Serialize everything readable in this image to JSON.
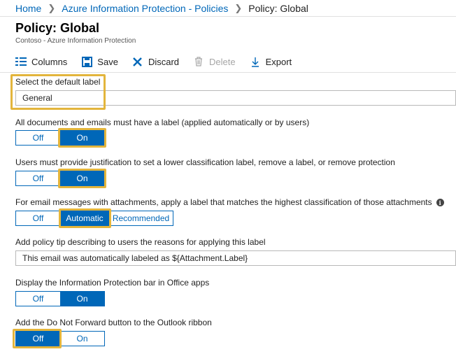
{
  "breadcrumb": {
    "items": [
      "Home",
      "Azure Information Protection - Policies"
    ],
    "current": "Policy: Global"
  },
  "page": {
    "title": "Policy: Global",
    "subtitle": "Contoso - Azure Information Protection"
  },
  "toolbar": {
    "columns": "Columns",
    "save": "Save",
    "discard": "Discard",
    "delete": "Delete",
    "export": "Export"
  },
  "settings": {
    "default_label": {
      "label": "Select the default label",
      "value": "General"
    },
    "mandatory_label": {
      "label": "All documents and emails must have a label (applied automatically or by users)",
      "off": "Off",
      "on": "On",
      "selected": "On"
    },
    "justification": {
      "label": "Users must provide justification to set a lower classification label, remove a label, or remove protection",
      "off": "Off",
      "on": "On",
      "selected": "On"
    },
    "attachments": {
      "label": "For email messages with attachments, apply a label that matches the highest classification of those attachments",
      "info_icon": "i",
      "off": "Off",
      "automatic": "Automatic",
      "recommended": "Recommended",
      "selected": "Automatic"
    },
    "policy_tip": {
      "label": "Add policy tip describing to users the reasons for applying this label",
      "value": "This email was automatically labeled as ${Attachment.Label}"
    },
    "ip_bar": {
      "label": "Display the Information Protection bar in Office apps",
      "off": "Off",
      "on": "On",
      "selected": "On"
    },
    "do_not_forward": {
      "label": "Add the Do Not Forward button to the Outlook ribbon",
      "off": "Off",
      "on": "On",
      "selected": "Off"
    }
  },
  "colors": {
    "accent": "#0067b8",
    "highlight": "#e3b53c"
  }
}
